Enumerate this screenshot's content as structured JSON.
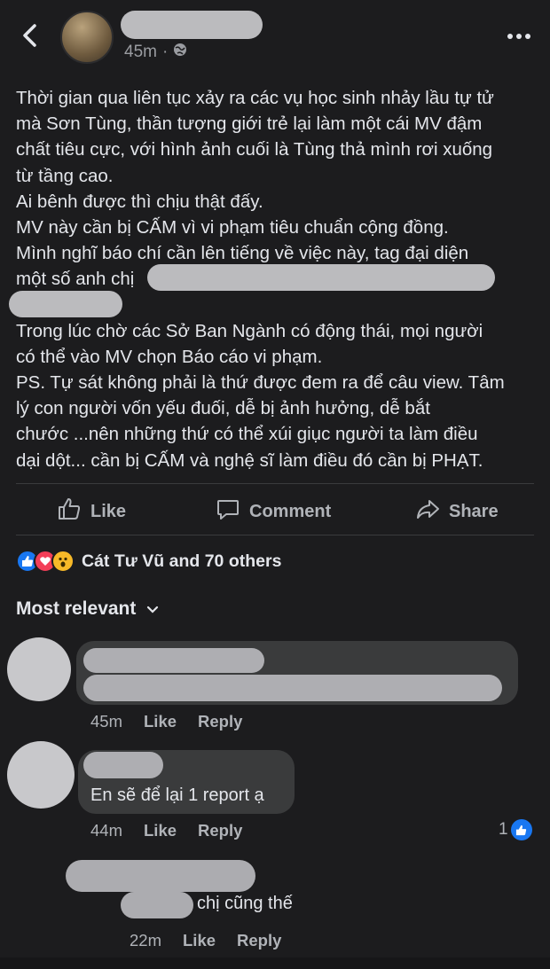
{
  "header": {
    "time": "45m",
    "separator": "·"
  },
  "post": {
    "lines": [
      "Thời gian qua liên tục xảy ra các vụ học sinh nhảy lầu tự tử",
      "mà Sơn Tùng, thần tượng giới trẻ lại làm một cái MV đậm",
      "chất tiêu cực, với hình ảnh cuối là Tùng thả mình rơi xuống",
      "từ tầng cao.",
      "Ai bênh được thì chịu thật đấy.",
      "MV này cần bị CẤM vì vi phạm tiêu chuẩn cộng đồng.",
      "Mình nghĩ báo chí cần lên tiếng về việc này, tag đại diện",
      "một số anh chị"
    ],
    "lines2": [
      "Trong lúc chờ các Sở Ban Ngành có động thái, mọi người",
      "có thể vào MV chọn Báo cáo vi phạm.",
      "PS. Tự sát không phải là thứ được đem ra để câu view. Tâm",
      "lý con người vốn yếu đuối, dễ bị ảnh hưởng, dễ bắt",
      "chước ...nên những thứ có thể xúi giục người ta làm điều",
      "dại dột... cần bị CẤM và nghệ sĩ làm điều đó cần bị PHẠT."
    ]
  },
  "actions": {
    "like": "Like",
    "comment": "Comment",
    "share": "Share"
  },
  "reactions": {
    "text": "Cát Tư Vũ and 70 others",
    "icons": [
      "like-icon",
      "love-icon",
      "wow-icon"
    ],
    "colors": {
      "like": "#1877f2",
      "love": "#f33e58",
      "wow": "#f7b928"
    }
  },
  "sort": {
    "label": "Most relevant"
  },
  "comments": [
    {
      "time": "45m",
      "like": "Like",
      "reply": "Reply"
    },
    {
      "text": "En sẽ để lại 1 report ạ",
      "time": "44m",
      "like": "Like",
      "reply": "Reply",
      "like_count": "1"
    },
    {
      "text": "chị cũng thế",
      "time": "22m",
      "like": "Like",
      "reply": "Reply"
    }
  ]
}
